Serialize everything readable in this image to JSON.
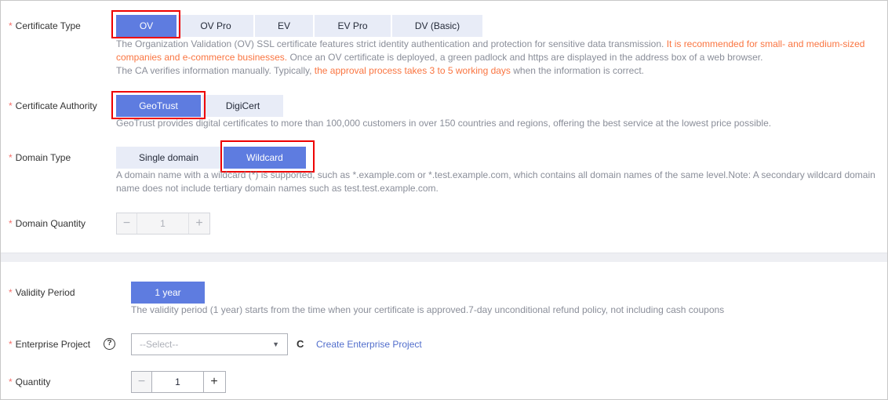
{
  "certificate_type": {
    "label": "Certificate Type",
    "options": [
      "OV",
      "OV Pro",
      "EV",
      "EV Pro",
      "DV (Basic)"
    ],
    "selected": "OV",
    "desc_line1_a": "The Organization Validation (OV) SSL certificate features strict identity authentication and protection for sensitive data transmission. ",
    "desc_line1_b": "It is recommended for small- and medium-sized",
    "desc_line2_a": "companies and e-commerce businesses.",
    "desc_line2_b": " Once an OV certificate is deployed, a green padlock and https are displayed in the address box of a web browser.",
    "desc_line3_a": "The CA verifies information manually. Typically, ",
    "desc_line3_b": "the approval process takes 3 to 5 working days",
    "desc_line3_c": " when the information is correct."
  },
  "certificate_authority": {
    "label": "Certificate Authority",
    "options": [
      "GeoTrust",
      "DigiCert"
    ],
    "selected": "GeoTrust",
    "desc": "GeoTrust provides digital certificates to more than 100,000 customers in over 150 countries and regions, offering the best service at the lowest price possible."
  },
  "domain_type": {
    "label": "Domain Type",
    "options": [
      "Single domain",
      "Wildcard"
    ],
    "selected": "Wildcard",
    "desc_line1": "A domain name with a wildcard (*) is supported, such as *.example.com or *.test.example.com, which contains all domain names of the same level.Note: A secondary wildcard domain",
    "desc_line2": "name does not include tertiary domain names such as test.test.example.com."
  },
  "domain_quantity": {
    "label": "Domain Quantity",
    "value": "1",
    "minus": "−",
    "plus": "+"
  },
  "validity_period": {
    "label": "Validity Period",
    "option": "1 year",
    "desc": "The validity period (1 year) starts from the time when your certificate is approved.7-day unconditional refund policy, not including cash coupons"
  },
  "enterprise_project": {
    "label": "Enterprise Project",
    "help": "?",
    "placeholder": "--Select--",
    "caret": "▼",
    "refresh": "C",
    "create_link": "Create Enterprise Project"
  },
  "quantity": {
    "label": "Quantity",
    "value": "1",
    "minus": "−",
    "plus": "+"
  },
  "required_mark": "*",
  "colors": {
    "accent": "#5e7ce0",
    "unselected": "#e8ecf7",
    "highlight": "#e00000",
    "orange_text": "#fa7541",
    "required": "#f66f6a",
    "link": "#526ecc"
  }
}
